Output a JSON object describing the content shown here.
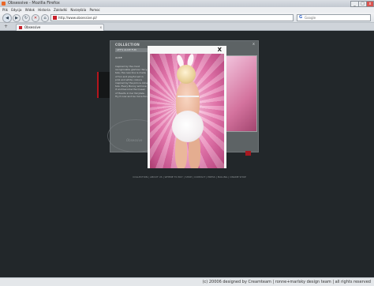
{
  "window": {
    "title": "Obsessive - Mozilla Firefox",
    "minimize": "_",
    "maximize": "□",
    "close": "x"
  },
  "menu": {
    "items": [
      "Plik",
      "Edycja",
      "Widok",
      "Historia",
      "Zakładki",
      "Narzędzia",
      "Pomoc"
    ]
  },
  "nav": {
    "url": "http://www.obsessive.pl/",
    "search_placeholder": "Google",
    "search_icon": "G"
  },
  "tabs": [
    {
      "label": "Obsessive"
    }
  ],
  "page": {
    "header": "COLLECTION",
    "subheader": "LET'S ALICE FUN",
    "intro": "ALICE",
    "body": "Inspired by the most recognisable glamour fairy-tale, the new line is made of fun and playful set in pink and white colours inspired by the prince Alice tale. Every Bunny will love it and become the Queen of Hearts in her fairytale. Try it now and be more fun.",
    "logo_text": "Obsessive",
    "footer_links": "COLLECTION | ABOUT US | WHERE TO BUY | SHOP | CONTACT | PRESS | MAILING | ONLINE SHOP"
  },
  "modal": {
    "close_label": "X"
  },
  "status": {
    "text": "(c) 20006 designed by Creamteam | ronne+marlsky design team | all rights reserved"
  }
}
